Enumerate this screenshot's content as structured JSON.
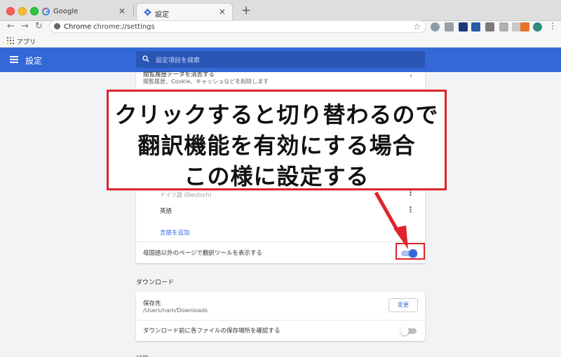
{
  "tabs": [
    {
      "title": "Google",
      "favicon": "google-icon"
    },
    {
      "title": "設定",
      "favicon": "gear-icon",
      "active": true
    }
  ],
  "toolbar": {
    "site_label": "Chrome",
    "url": "chrome://settings"
  },
  "bookmarks": {
    "apps_label": "アプリ"
  },
  "header": {
    "title": "設定",
    "search_placeholder": "設定項目を検索"
  },
  "languages": {
    "clear_title": "閲覧履歴データを消去する",
    "clear_sub": "閲覧履歴、Cookie、キャッシュなどを削除します",
    "partial_item": "ドイツ語 (Deutsch)",
    "english_item": "英語",
    "add_language": "言語を追加",
    "translate_label": "母国語以外のページで翻訳ツールを表示する",
    "translate_enabled": true
  },
  "downloads": {
    "section_title": "ダウンロード",
    "location_title": "保存先",
    "location_path": "/Users/nam/Downloads",
    "change_button": "変更",
    "ask_label": "ダウンロード前に各ファイルの保存場所を確認する",
    "ask_enabled": false,
    "next_section_partial": "印刷"
  },
  "annotation": {
    "line1": "クリックすると切り替わるので",
    "line2": "翻訳機能を有効にする場合",
    "line3": "この様に設定する"
  },
  "colors": {
    "header_blue": "#3368d6",
    "annotation_red": "#e0232c",
    "toggle_on_track": "#a7c1f2",
    "toggle_on_knob": "#3367d6",
    "toggle_off_track": "#bdbdbd",
    "toggle_off_knob": "#ffffff"
  }
}
